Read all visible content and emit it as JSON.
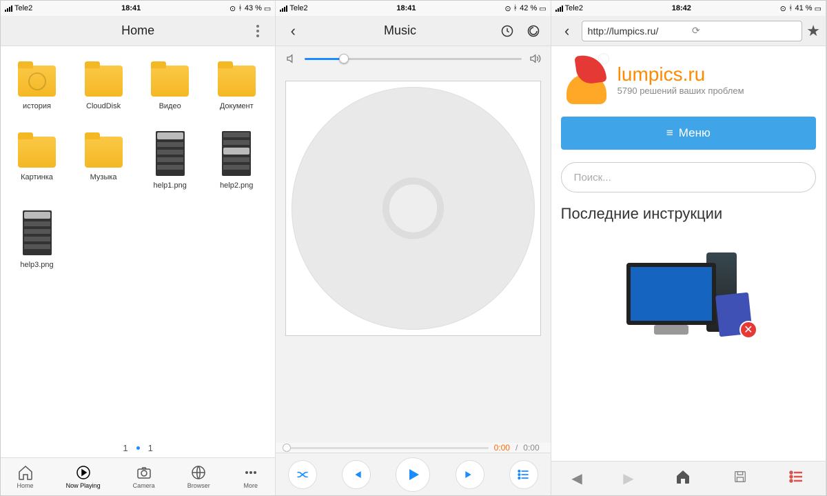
{
  "screen1": {
    "status": {
      "carrier": "Tele2",
      "time": "18:41",
      "battery": "43 %"
    },
    "title": "Home",
    "items": [
      {
        "label": "история",
        "type": "folder",
        "variant": "history"
      },
      {
        "label": "CloudDisk",
        "type": "folder"
      },
      {
        "label": "Видео",
        "type": "folder"
      },
      {
        "label": "Документ",
        "type": "folder"
      },
      {
        "label": "Картинка",
        "type": "folder"
      },
      {
        "label": "Музыка",
        "type": "folder"
      },
      {
        "label": "help1.png",
        "type": "image"
      },
      {
        "label": "help2.png",
        "type": "image"
      },
      {
        "label": "help3.png",
        "type": "image"
      }
    ],
    "pager": {
      "current": "1",
      "total": "1"
    },
    "tabs": [
      {
        "label": "Home"
      },
      {
        "label": "Now Playing"
      },
      {
        "label": "Camera"
      },
      {
        "label": "Browser"
      },
      {
        "label": "More"
      }
    ]
  },
  "screen2": {
    "status": {
      "carrier": "Tele2",
      "time": "18:41",
      "battery": "42 %"
    },
    "title": "Music",
    "volume_percent": 18,
    "time": {
      "current": "0:00",
      "total": "0:00",
      "separator": "/"
    }
  },
  "screen3": {
    "status": {
      "carrier": "Tele2",
      "time": "18:42",
      "battery": "41 %"
    },
    "url": "http://lumpics.ru/",
    "site": {
      "title": "lumpics.ru",
      "subtitle": "5790 решений ваших проблем"
    },
    "menu_label": "Меню",
    "search_placeholder": "Поиск...",
    "section_heading": "Последние инструкции"
  },
  "style": {
    "accent": "#1a8cff",
    "orange": "#ff6a00",
    "folder": "#f4b824"
  }
}
